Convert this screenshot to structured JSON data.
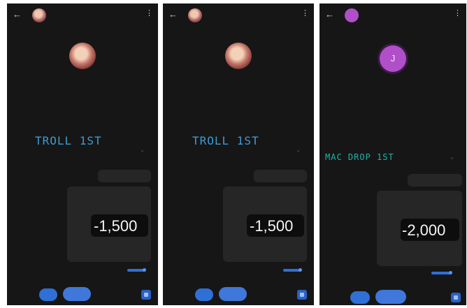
{
  "screens": [
    {
      "header": {
        "back_icon": "arrow-left-icon",
        "title": "",
        "status": "",
        "menu_icon": "more-vertical-icon"
      },
      "profile": {
        "name": "",
        "line1": "",
        "line2": "",
        "avatar_color": "#a35a5a"
      },
      "message": {
        "text": "TROLL 1ST",
        "color": "#3d9bd3"
      },
      "reply": {
        "text": ""
      },
      "amount": {
        "caption": "",
        "value": "-1,500",
        "footer": ""
      },
      "toggle_label": "",
      "actions": {
        "pay": "",
        "request": "",
        "more": ""
      }
    },
    {
      "header": {
        "back_icon": "arrow-left-icon",
        "title": "",
        "status": "",
        "menu_icon": "more-vertical-icon"
      },
      "profile": {
        "name": "",
        "line1": "",
        "line2": "",
        "avatar_color": "#a35a5a"
      },
      "message": {
        "text": "TROLL 1ST",
        "color": "#3d9bd3"
      },
      "reply": {
        "text": ""
      },
      "amount": {
        "caption": "",
        "value": "-1,500",
        "footer": ""
      },
      "toggle_label": "",
      "actions": {
        "pay": "",
        "request": "",
        "more": ""
      }
    },
    {
      "header": {
        "back_icon": "arrow-left-icon",
        "title": "",
        "status": "",
        "menu_icon": "more-vertical-icon"
      },
      "profile": {
        "name": "",
        "line1": "",
        "line2": "",
        "avatar_color": "#b04fc8",
        "avatar_letter": "J"
      },
      "message": {
        "text": "MAC DROP 1ST",
        "color": "#1fb3a8"
      },
      "reply": {
        "text": ""
      },
      "amount": {
        "caption": "",
        "value": "-2,000",
        "footer": ""
      },
      "toggle_label": "",
      "actions": {
        "pay": "",
        "request": "",
        "more": ""
      }
    }
  ],
  "colors": {
    "background": "#161616",
    "accent": "#2f6fd6",
    "text": "#f4f4f4"
  }
}
